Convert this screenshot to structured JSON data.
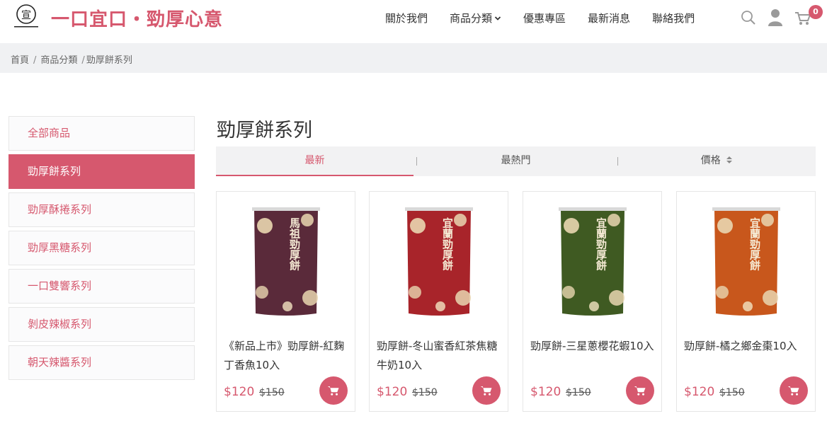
{
  "brand": {
    "title": "一口宜口・勁厚心意",
    "accent_color": "#d6586e"
  },
  "nav": {
    "items": [
      "關於我們",
      "商品分類",
      "優惠專區",
      "最新消息",
      "聯絡我們"
    ]
  },
  "header_icons": {
    "search": "search-icon",
    "user": "user-icon",
    "cart": "cart-icon",
    "cart_count": "0"
  },
  "breadcrumb": {
    "items": [
      "首頁",
      "商品分類",
      "勁厚餅系列"
    ],
    "separator": "/"
  },
  "sidebar": {
    "items": [
      {
        "label": "全部商品",
        "active": false
      },
      {
        "label": "勁厚餅系列",
        "active": true
      },
      {
        "label": "勁厚酥捲系列",
        "active": false
      },
      {
        "label": "勁厚黑糖系列",
        "active": false
      },
      {
        "label": "一口雙響系列",
        "active": false
      },
      {
        "label": "剝皮辣椒系列",
        "active": false
      },
      {
        "label": "朝天辣醬系列",
        "active": false
      }
    ]
  },
  "main": {
    "title": "勁厚餅系列",
    "sort_tabs": [
      {
        "label": "最新",
        "active": true
      },
      {
        "label": "最熱門",
        "active": false
      },
      {
        "label": "價格",
        "active": false
      }
    ],
    "products": [
      {
        "name": "《新品上市》勁厚餅-紅麴丁香魚10入",
        "price": "$120",
        "old_price": "$150",
        "pack_color": "#5a2a3a",
        "pack_label": "馬祖勁厚餅"
      },
      {
        "name": "勁厚餅-冬山蜜香紅茶焦糖牛奶10入",
        "price": "$120",
        "old_price": "$150",
        "pack_color": "#a8242a",
        "pack_label": "宜蘭勁厚餅"
      },
      {
        "name": "勁厚餅-三星蔥櫻花蝦10入",
        "price": "$120",
        "old_price": "$150",
        "pack_color": "#3f5a22",
        "pack_label": "宜蘭勁厚餅"
      },
      {
        "name": "勁厚餅-橘之鄉金棗10入",
        "price": "$120",
        "old_price": "$150",
        "pack_color": "#c8571c",
        "pack_label": "宜蘭勁厚餅"
      }
    ]
  }
}
